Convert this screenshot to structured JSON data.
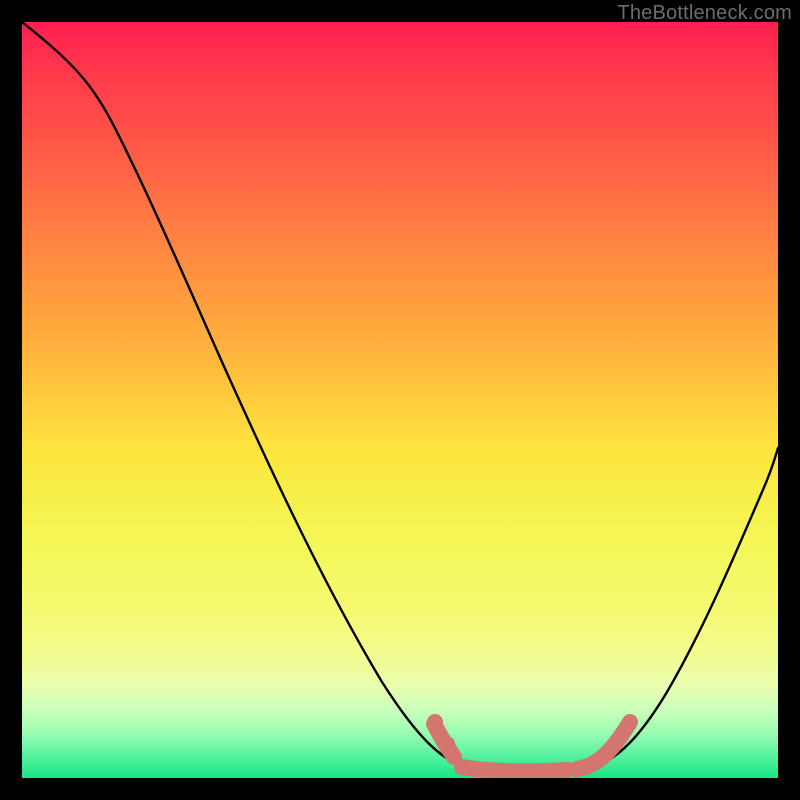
{
  "watermark": "TheBottleneck.com",
  "gradient": {
    "top": "#ff1f50",
    "mid": "#ffe33e",
    "bottom": "#18e686"
  },
  "chart_data": {
    "type": "line",
    "title": "",
    "xlabel": "",
    "ylabel": "",
    "xlim": [
      0,
      100
    ],
    "ylim": [
      0,
      100
    ],
    "grid": false,
    "legend": false,
    "series": [
      {
        "name": "bottleneck-curve",
        "color": "#000000",
        "x": [
          0,
          6,
          12,
          18,
          24,
          30,
          36,
          42,
          46,
          50,
          54,
          58,
          62,
          66,
          70,
          74,
          78,
          82,
          86,
          90,
          94,
          98,
          100
        ],
        "values": [
          100,
          95,
          87,
          78,
          68,
          57,
          46,
          35,
          25,
          16,
          9,
          4,
          1,
          0,
          0,
          0,
          2,
          7,
          14,
          23,
          33,
          44,
          50
        ]
      },
      {
        "name": "optimal-zone-marker",
        "color": "#d4766f",
        "x": [
          55,
          57,
          59,
          61,
          63,
          65,
          67,
          69,
          71,
          73,
          75,
          77,
          79,
          81
        ],
        "values": [
          5,
          3,
          1,
          0,
          0,
          0,
          0,
          0,
          0,
          0,
          1,
          2,
          5,
          8
        ]
      }
    ],
    "annotations": []
  }
}
